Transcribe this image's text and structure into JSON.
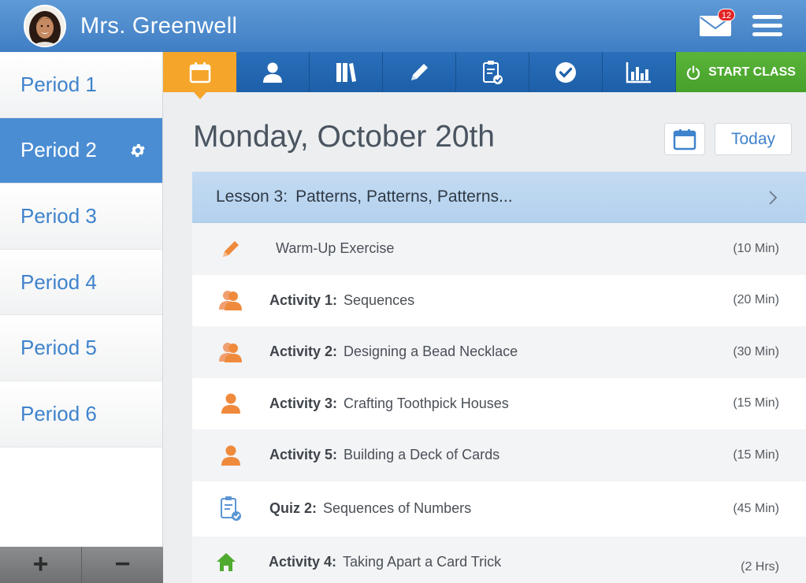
{
  "header": {
    "teacher_name": "Mrs. Greenwell",
    "mail_count": "12"
  },
  "sidebar": {
    "periods": [
      {
        "label": "Period 1"
      },
      {
        "label": "Period 2"
      },
      {
        "label": "Period 3"
      },
      {
        "label": "Period 4"
      },
      {
        "label": "Period 5"
      },
      {
        "label": "Period 6"
      }
    ],
    "active_period": "Period 2",
    "add_label": "+",
    "remove_label": "−"
  },
  "toolbar": {
    "tabs": [
      "calendar-icon",
      "student-icon",
      "books-icon",
      "pencil-icon",
      "clipboard-check-icon",
      "checkmark-icon",
      "bar-chart-icon"
    ],
    "start_class_label": "START CLASS"
  },
  "main": {
    "date_title": "Monday, October 20th",
    "today_label": "Today",
    "lesson": {
      "number": "Lesson 3:",
      "title": "Patterns, Patterns, Patterns..."
    },
    "items": [
      {
        "prefix": "",
        "title": "Warm-Up Exercise",
        "duration": "(10 Min)",
        "icon": "pencil-icon"
      },
      {
        "prefix": "Activity 1:",
        "title": "Sequences",
        "duration": "(20 Min)",
        "icon": "group-icon"
      },
      {
        "prefix": "Activity 2:",
        "title": "Designing a Bead Necklace",
        "duration": "(30 Min)",
        "icon": "group-icon"
      },
      {
        "prefix": "Activity 3:",
        "title": "Crafting Toothpick Houses",
        "duration": "(15 Min)",
        "icon": "person-icon"
      },
      {
        "prefix": "Activity 5:",
        "title": "Building a Deck of Cards",
        "duration": "(15 Min)",
        "icon": "person-icon"
      },
      {
        "prefix": "Quiz 2:",
        "title": "Sequences of Numbers",
        "duration": "(45 Min)",
        "icon": "quiz-icon"
      },
      {
        "prefix": "Activity 4:",
        "title": "Taking Apart a Card Trick",
        "duration": "(2 Hrs)",
        "icon": "home-icon"
      }
    ]
  },
  "colors": {
    "brand_blue": "#3f83cc",
    "accent_orange": "#f4a52a",
    "start_green": "#4fab30",
    "icon_orange": "#ef8a3c"
  }
}
